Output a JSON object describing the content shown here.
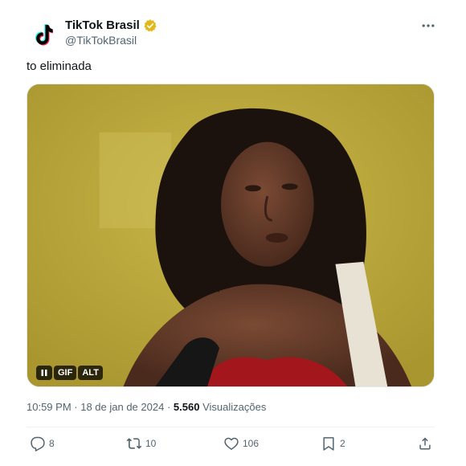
{
  "author": {
    "display_name": "TikTok Brasil",
    "handle": "@TikTokBrasil",
    "avatar_icon": "tiktok-logo-icon",
    "verified_icon": "verified-gold-badge-icon",
    "verified_color": "#e2b719"
  },
  "more_icon": "more-horizontal-icon",
  "tweet": {
    "text": "to eliminada"
  },
  "media": {
    "type": "gif",
    "pause_icon": "pause-icon",
    "gif_label": "GIF",
    "alt_label": "ALT"
  },
  "meta": {
    "time": "10:59 PM",
    "separator": " · ",
    "date": "18 de jan de 2024",
    "views_count": "5.560",
    "views_label": "Visualizações"
  },
  "actions": {
    "replies": {
      "icon": "reply-icon",
      "count": "8"
    },
    "retweets": {
      "icon": "retweet-icon",
      "count": "10"
    },
    "likes": {
      "icon": "heart-icon",
      "count": "106"
    },
    "bookmarks": {
      "icon": "bookmark-icon",
      "count": "2"
    },
    "share": {
      "icon": "share-icon"
    }
  },
  "colors": {
    "text_primary": "#0f1419",
    "text_secondary": "#536471",
    "divider": "#eff3f4"
  }
}
